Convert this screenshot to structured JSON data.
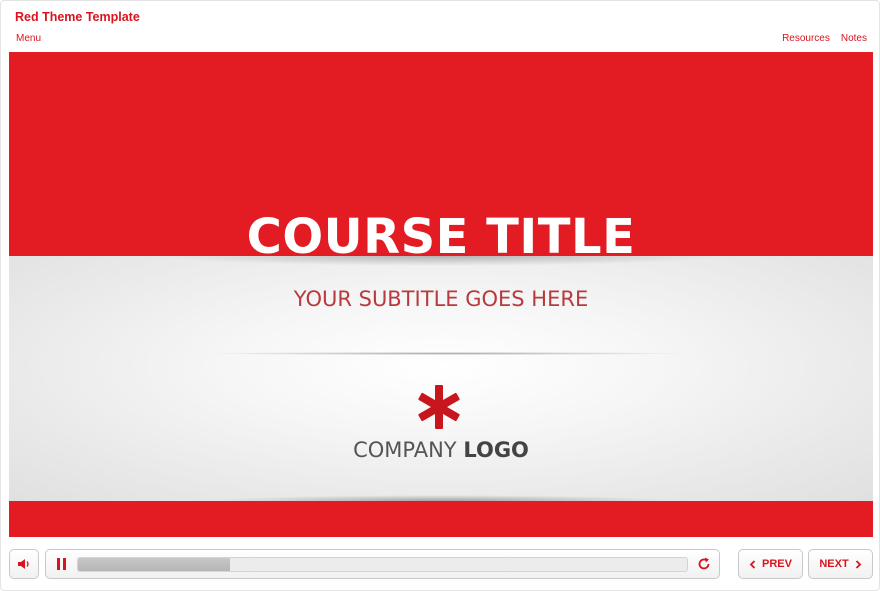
{
  "app": {
    "title": "Red Theme Template"
  },
  "nav": {
    "menu": "Menu",
    "resources": "Resources",
    "notes": "Notes"
  },
  "slide": {
    "course_title": "COURSE TITLE",
    "subtitle": "YOUR SUBTITLE GOES HERE",
    "logo_word1": "COMPANY",
    "logo_word2": "LOGO"
  },
  "player": {
    "progress": 0.25,
    "prev_label": "PREV",
    "next_label": "NEXT"
  },
  "icons": {
    "volume": "speaker-icon",
    "pause": "pause-icon",
    "replay": "replay-icon",
    "prev": "chevron-left-icon",
    "next": "chevron-right-icon"
  },
  "colors": {
    "accent": "#e31c24",
    "text_red": "#d8141f",
    "subtitle": "#b83a3e",
    "logo_text": "#555555"
  }
}
